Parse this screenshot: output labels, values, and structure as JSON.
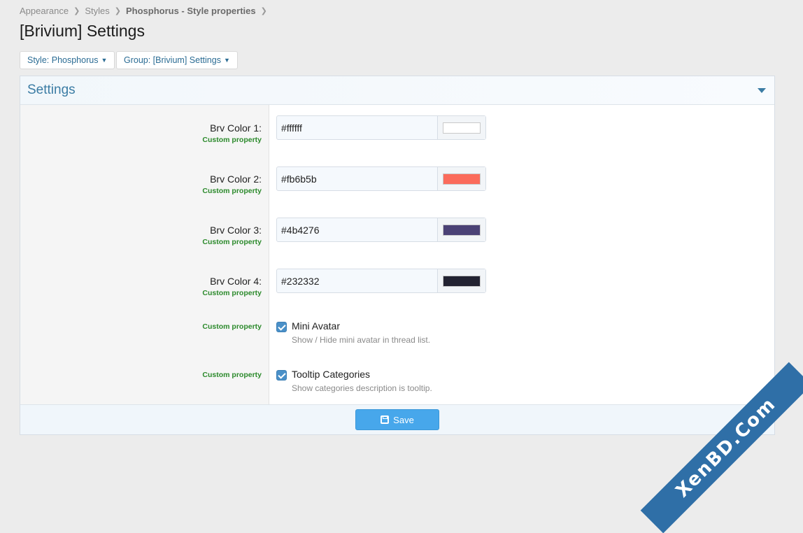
{
  "breadcrumb": [
    "Appearance",
    "Styles",
    "Phosphorus - Style properties"
  ],
  "page_title": "[Brivium] Settings",
  "filters": {
    "style": "Style: Phosphorus",
    "group": "Group: [Brivium] Settings"
  },
  "block": {
    "title": "Settings",
    "colors": [
      {
        "label": "Brv Color 1:",
        "hint": "Custom property",
        "value": "#ffffff",
        "swatch": "#ffffff"
      },
      {
        "label": "Brv Color 2:",
        "hint": "Custom property",
        "value": "#fb6b5b",
        "swatch": "#fb6b5b"
      },
      {
        "label": "Brv Color 3:",
        "hint": "Custom property",
        "value": "#4b4276",
        "swatch": "#4b4276"
      },
      {
        "label": "Brv Color 4:",
        "hint": "Custom property",
        "value": "#232332",
        "swatch": "#232332"
      }
    ],
    "checkboxes": [
      {
        "hint": "Custom property",
        "label": "Mini Avatar",
        "description": "Show / Hide mini avatar in thread list.",
        "checked": true
      },
      {
        "hint": "Custom property",
        "label": "Tooltip Categories",
        "description": "Show categories description is tooltip.",
        "checked": true
      }
    ],
    "save_label": "Save"
  },
  "watermark": "XenBD.Com",
  "colors": {
    "accent": "#47a7eb",
    "link": "#2b6c94",
    "hint_green": "#2c8a2c",
    "watermark_bg": "#2f6fa7"
  }
}
